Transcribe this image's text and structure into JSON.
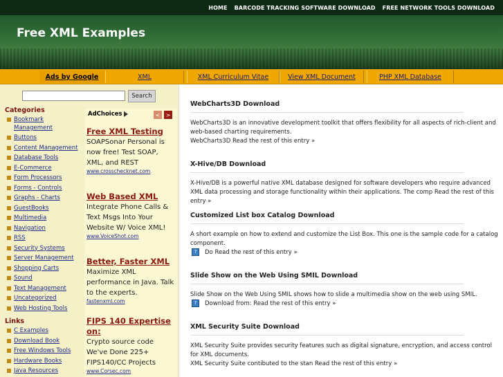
{
  "top_links": [
    "HOME",
    "BARCODE TRACKING SOFTWARE DOWNLOAD",
    "FREE NETWORK TOOLS DOWNLOAD"
  ],
  "site_title": "Free XML Examples",
  "nav": [
    "Ads by Google",
    "XML",
    "XML Curriculum Vitae",
    "View XML Document",
    "PHP XML Database"
  ],
  "search": {
    "value": "",
    "button_label": "Search"
  },
  "categories": {
    "title": "Categories",
    "items": [
      "Bookmark Management",
      "Buttons",
      "Content Management",
      "Database Tools",
      "E-Commerce",
      "Form Processors",
      "Forms - Controls",
      "Graphs - Charts",
      "GuestBooks",
      "Multimedia",
      "Navigation",
      "RSS",
      "Security Systems",
      "Server Management",
      "Shopping Carts",
      "Sound",
      "Text Management",
      "Uncategorized",
      "Web Hosting Tools"
    ]
  },
  "links": {
    "title": "Links",
    "items": [
      "C Examples",
      "Download Book",
      "Free Windows Tools",
      "Hardware Books",
      "Java Resources"
    ]
  },
  "ads": {
    "adchoices_label": "AdChoices",
    "prev_arrow": "<",
    "next_arrow": ">",
    "items": [
      {
        "title": "Free XML Testing",
        "body": "SOAPSonar Personal is now free! Test SOAP, XML, and REST",
        "url": "www.crosschecknet.com"
      },
      {
        "title": "Web Based XML",
        "body": "Integrate Phone Calls & Text Msgs Into Your Website W/ Voice XML!",
        "url": "www.VoiceShot.com"
      },
      {
        "title": "Better, Faster XML",
        "body": "Maximize XML performance in Java. Talk to the experts.",
        "url": "fastenxml.com"
      },
      {
        "title": "FIPS 140 Expertise on:",
        "body": "Crypto source code We've Done 225+ FIPS140/CC Projects",
        "url": "www.Corsec.com"
      }
    ]
  },
  "articles": [
    {
      "title": "WebCharts3D Download",
      "lines": [
        "WebCharts3D is an innovative development toolkit that offers flexibility for all aspects of rich-client and web-based charting requirements.",
        "WebCharts3D Read the rest of this entry »"
      ],
      "icon_line": ""
    },
    {
      "title": "X-Hive/DB Download",
      "lines": [
        "X-Hive/DB is a powerful native XML database designed for software developers who require advanced XML data processing and storage functionality within their applications. The comp Read the rest of this entry »"
      ],
      "icon_line": ""
    },
    {
      "title": "Customized List box Catalog Download",
      "lines": [
        "A short example on how to extend and customize the List Box. This one is the sample code for a catalog component."
      ],
      "icon_line": "Do Read the rest of this entry »"
    },
    {
      "title": "Slide Show on the Web Using SMIL Download",
      "lines": [
        "Slide Show on the Web Using SMIL shows how to slide a multimedia show on the web using SMIL."
      ],
      "icon_line": "Download from: Read the rest of this entry »"
    },
    {
      "title": "XML Security Suite Download",
      "lines": [
        "XML Security Suite provides security features such as digital signature, encryption, and access control for XML documents.",
        "XML Security Suite contibuted to the stan Read the rest of this entry »"
      ],
      "icon_line": ""
    }
  ]
}
